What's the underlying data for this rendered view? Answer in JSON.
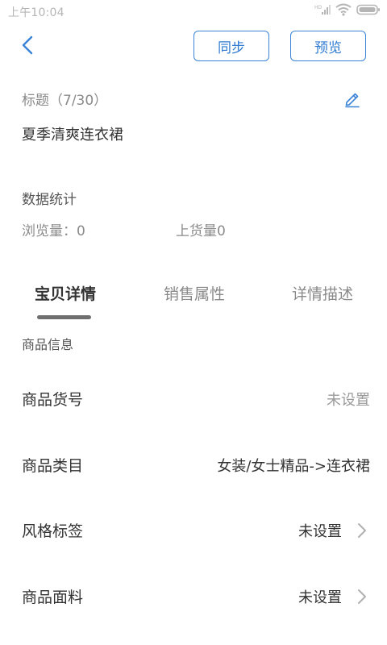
{
  "status_bar": {
    "time": "上午10:04",
    "icons": [
      "hd-signal-icon",
      "wifi-icon",
      "battery-icon"
    ]
  },
  "header": {
    "back_icon": "chevron-left-icon",
    "sync_label": "同步",
    "preview_label": "预览",
    "accent_color": "#2f7bd1"
  },
  "title": {
    "label": "标题（7/30）",
    "value": "夏季清爽连衣裙",
    "edit_icon": "pencil-icon"
  },
  "stats": {
    "heading": "数据统计",
    "views": "浏览量：0",
    "listed": "上货量0"
  },
  "tabs": [
    {
      "label": "宝贝详情",
      "active": true
    },
    {
      "label": "销售属性",
      "active": false
    },
    {
      "label": "详情描述",
      "active": false
    }
  ],
  "product": {
    "heading": "商品信息",
    "rows": [
      {
        "label": "商品货号",
        "value": "未设置"
      },
      {
        "label": "商品类目",
        "value": "女装/女士精品->连衣裙"
      },
      {
        "label": "风格标签",
        "value": "未设置"
      },
      {
        "label": "商品面料",
        "value": "未设置"
      }
    ]
  }
}
